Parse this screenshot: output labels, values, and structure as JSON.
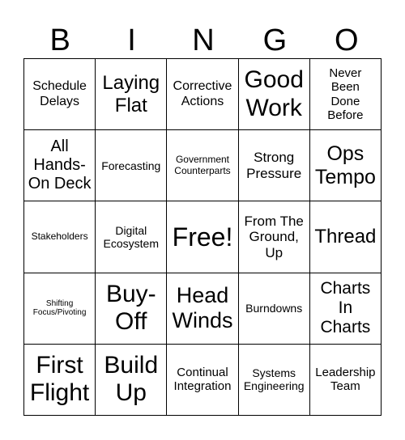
{
  "header": [
    "B",
    "I",
    "N",
    "G",
    "O"
  ],
  "cells": [
    "Schedule\nDelays",
    "Laying\nFlat",
    "Corrective\nActions",
    "Good\nWork",
    "Never\nBeen\nDone\nBefore",
    "All\nHands-\nOn Deck",
    "Forecasting",
    "Government\nCounterparts",
    "Strong\nPressure",
    "Ops\nTempo",
    "Stakeholders",
    "Digital\nEcosystem",
    "Free!",
    "From The\nGround,\nUp",
    "Thread",
    "Shifting\nFocus/Pivoting",
    "Buy-\nOff",
    "Head\nWinds",
    "Burndowns",
    "Charts\nIn\nCharts",
    "First\nFlight",
    "Build\nUp",
    "Continual\nIntegration",
    "Systems\nEngineering",
    "Leadership\nTeam"
  ]
}
